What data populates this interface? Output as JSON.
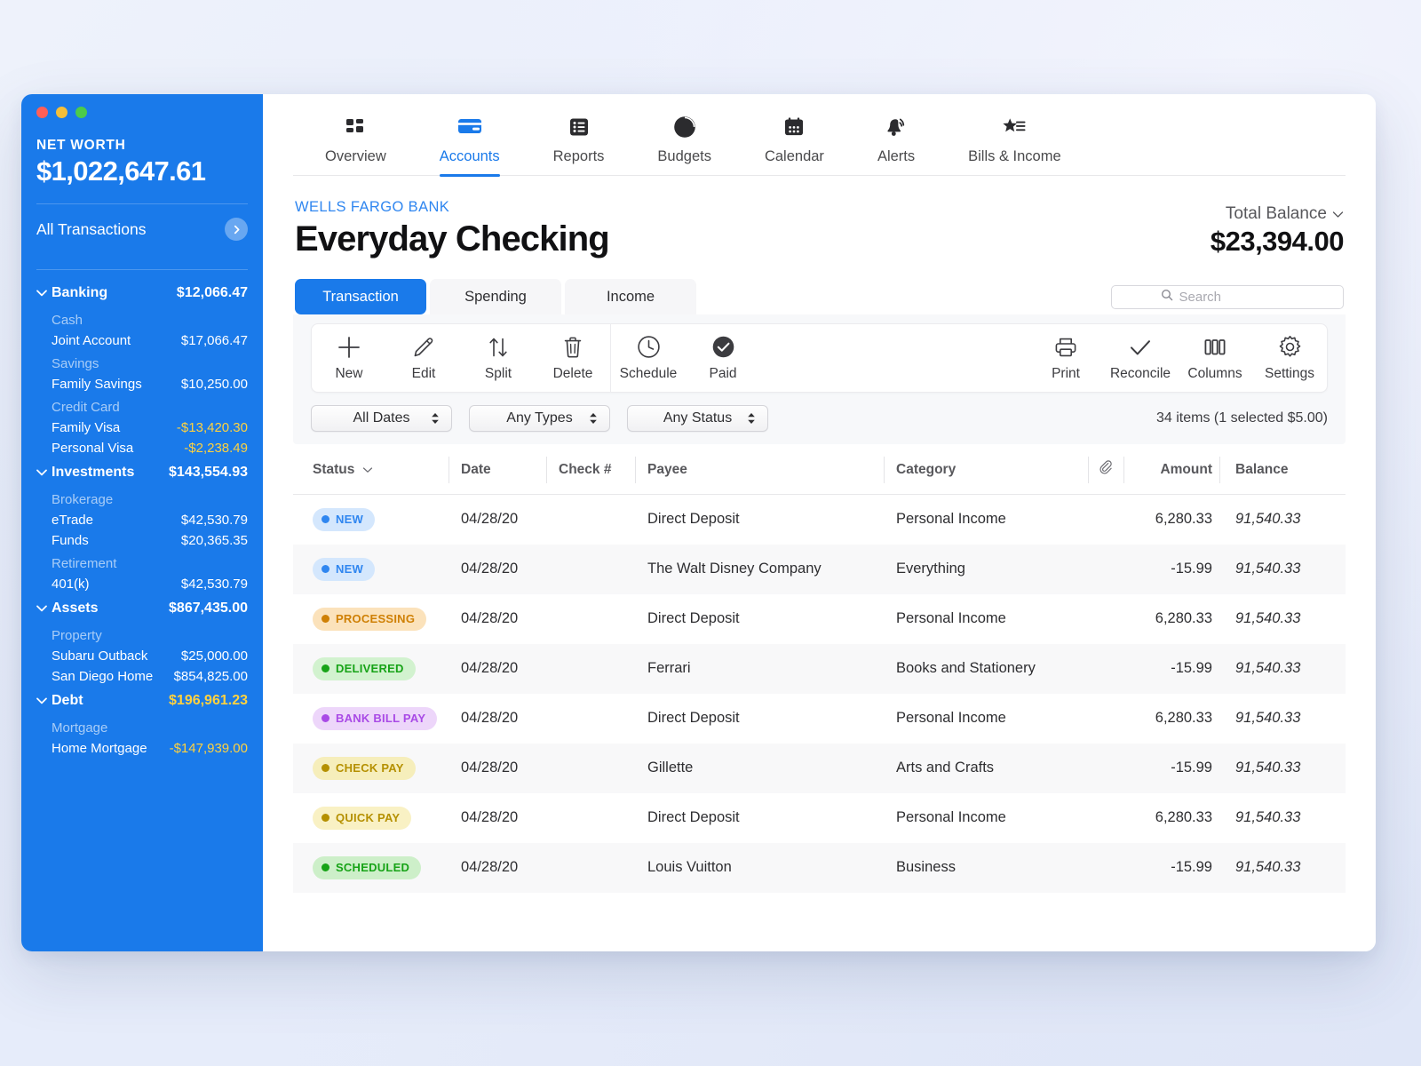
{
  "sidebar": {
    "net_worth_label": "NET WORTH",
    "net_worth_value": "$1,022,647.61",
    "all_transactions_label": "All Transactions",
    "groups": [
      {
        "name": "Banking",
        "amount": "$12,066.47",
        "negative": false,
        "sections": [
          {
            "heading": "Cash",
            "accounts": [
              {
                "name": "Joint Account",
                "amount": "$17,066.47",
                "negative": false
              }
            ]
          },
          {
            "heading": "Savings",
            "accounts": [
              {
                "name": "Family Savings",
                "amount": "$10,250.00",
                "negative": false
              }
            ]
          },
          {
            "heading": "Credit Card",
            "accounts": [
              {
                "name": "Family Visa",
                "amount": "-$13,420.30",
                "negative": true
              },
              {
                "name": "Personal Visa",
                "amount": "-$2,238.49",
                "negative": true
              }
            ]
          }
        ]
      },
      {
        "name": "Investments",
        "amount": "$143,554.93",
        "negative": false,
        "sections": [
          {
            "heading": "Brokerage",
            "accounts": [
              {
                "name": "eTrade",
                "amount": "$42,530.79",
                "negative": false
              },
              {
                "name": "Funds",
                "amount": "$20,365.35",
                "negative": false
              }
            ]
          },
          {
            "heading": "Retirement",
            "accounts": [
              {
                "name": "401(k)",
                "amount": "$42,530.79",
                "negative": false
              }
            ]
          }
        ]
      },
      {
        "name": "Assets",
        "amount": "$867,435.00",
        "negative": false,
        "sections": [
          {
            "heading": "Property",
            "accounts": [
              {
                "name": "Subaru Outback",
                "amount": "$25,000.00",
                "negative": false
              },
              {
                "name": "San Diego Home",
                "amount": "$854,825.00",
                "negative": false
              }
            ]
          }
        ]
      },
      {
        "name": "Debt",
        "amount": "$196,961.23",
        "negative": true,
        "sections": [
          {
            "heading": "Mortgage",
            "accounts": [
              {
                "name": "Home Mortgage",
                "amount": "-$147,939.00",
                "negative": true
              }
            ]
          }
        ]
      }
    ]
  },
  "topnav": {
    "items": [
      {
        "label": "Overview",
        "icon": "grid-icon",
        "active": false
      },
      {
        "label": "Accounts",
        "icon": "credit-card-icon",
        "active": true
      },
      {
        "label": "Reports",
        "icon": "list-icon",
        "active": false
      },
      {
        "label": "Budgets",
        "icon": "pie-chart-icon",
        "active": false
      },
      {
        "label": "Calendar",
        "icon": "calendar-icon",
        "active": false
      },
      {
        "label": "Alerts",
        "icon": "bell-icon",
        "active": false
      },
      {
        "label": "Bills & Income",
        "icon": "bills-icon",
        "active": false
      }
    ]
  },
  "account": {
    "bank_name": "WELLS FARGO BANK",
    "title": "Everyday Checking",
    "balance_label": "Total Balance",
    "balance_value": "$23,394.00"
  },
  "tabs": [
    {
      "label": "Transaction",
      "active": true
    },
    {
      "label": "Spending",
      "active": false
    },
    {
      "label": "Income",
      "active": false
    }
  ],
  "search": {
    "placeholder": "Search",
    "value": ""
  },
  "toolbar": {
    "left": [
      {
        "label": "New",
        "icon": "plus-icon"
      },
      {
        "label": "Edit",
        "icon": "pencil-icon"
      },
      {
        "label": "Split",
        "icon": "split-arrows-icon"
      },
      {
        "label": "Delete",
        "icon": "trash-icon"
      }
    ],
    "middle": [
      {
        "label": "Schedule",
        "icon": "clock-icon"
      },
      {
        "label": "Paid",
        "icon": "check-circle-filled-icon"
      }
    ],
    "right": [
      {
        "label": "Print",
        "icon": "printer-icon"
      },
      {
        "label": "Reconcile",
        "icon": "check-icon"
      },
      {
        "label": "Columns",
        "icon": "columns-icon"
      },
      {
        "label": "Settings",
        "icon": "gear-icon"
      }
    ]
  },
  "filters": [
    {
      "label": "All Dates"
    },
    {
      "label": "Any Types"
    },
    {
      "label": "Any Status"
    }
  ],
  "items_count": "34 items (1 selected $5.00)",
  "table": {
    "columns": {
      "status": "Status",
      "date": "Date",
      "check": "Check #",
      "payee": "Payee",
      "category": "Category",
      "attachment": "paperclip-icon",
      "amount": "Amount",
      "balance": "Balance"
    },
    "rows": [
      {
        "status": "NEW",
        "status_color": "#2f86f0",
        "status_bg": "#d4e7fd",
        "date": "04/28/20",
        "check": "",
        "payee": "Direct Deposit",
        "category": "Personal Income",
        "amount": "6,280.33",
        "balance": "91,540.33"
      },
      {
        "status": "NEW",
        "status_color": "#2f86f0",
        "status_bg": "#d4e7fd",
        "date": "04/28/20",
        "check": "",
        "payee": "The Walt Disney Company",
        "category": "Everything",
        "amount": "-15.99",
        "balance": "91,540.33"
      },
      {
        "status": "PROCESSING",
        "status_color": "#cf8005",
        "status_bg": "#fbe2bb",
        "date": "04/28/20",
        "check": "",
        "payee": "Direct Deposit",
        "category": "Personal Income",
        "amount": "6,280.33",
        "balance": "91,540.33"
      },
      {
        "status": "DELIVERED",
        "status_color": "#17a317",
        "status_bg": "#d2f2cf",
        "date": "04/28/20",
        "check": "",
        "payee": "Ferrari",
        "category": "Books and Stationery",
        "amount": "-15.99",
        "balance": "91,540.33"
      },
      {
        "status": "BANK BILL PAY",
        "status_color": "#a94ae6",
        "status_bg": "#edd6fa",
        "date": "04/28/20",
        "check": "",
        "payee": "Direct Deposit",
        "category": "Personal Income",
        "amount": "6,280.33",
        "balance": "91,540.33"
      },
      {
        "status": "CHECK PAY",
        "status_color": "#b59000",
        "status_bg": "#f6eebb",
        "date": "04/28/20",
        "check": "",
        "payee": "Gillette",
        "category": "Arts and Crafts",
        "amount": "-15.99",
        "balance": "91,540.33"
      },
      {
        "status": "QUICK PAY",
        "status_color": "#b59000",
        "status_bg": "#f9f1c4",
        "date": "04/28/20",
        "check": "",
        "payee": "Direct Deposit",
        "category": "Personal Income",
        "amount": "6,280.33",
        "balance": "91,540.33"
      },
      {
        "status": "SCHEDULED",
        "status_color": "#17a317",
        "status_bg": "#cdefc9",
        "date": "04/28/20",
        "check": "",
        "payee": "Louis Vuitton",
        "category": "Business",
        "amount": "-15.99",
        "balance": "91,540.33"
      }
    ]
  },
  "colors": {
    "accent": "#1a7aea",
    "sidebar_bg": "#1a7aea",
    "negative": "#ffd23f"
  }
}
